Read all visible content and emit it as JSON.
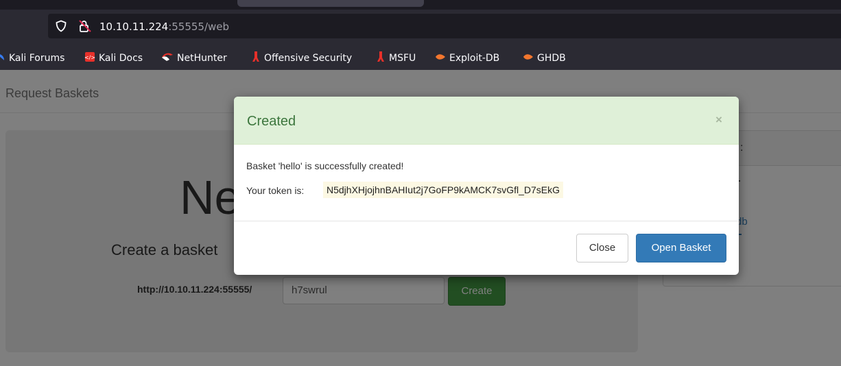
{
  "browser": {
    "url_host": "10.10.11.224",
    "url_rest": ":55555/web",
    "bookmarks": [
      {
        "label": "Kali Forums",
        "icon": "kali-dragon-icon"
      },
      {
        "label": "Kali Docs",
        "icon": "kali-docs-icon"
      },
      {
        "label": "NetHunter",
        "icon": "nethunter-icon"
      },
      {
        "label": "Offensive Security",
        "icon": "offsec-icon"
      },
      {
        "label": "MSFU",
        "icon": "offsec-icon"
      },
      {
        "label": "Exploit-DB",
        "icon": "exploitdb-icon"
      },
      {
        "label": "GHDB",
        "icon": "exploitdb-icon"
      }
    ]
  },
  "page": {
    "brand": "Request Baskets",
    "heading_fragment": "Ne",
    "lead_fragment": "Create a basket",
    "basket_url_prefix": "http://10.10.11.224:55555/",
    "basket_name_value": "h7swrul",
    "create_label": "Create",
    "side_fragment_colon": ":",
    "side_fragment_link": "db"
  },
  "modal": {
    "title": "Created",
    "close_symbol": "×",
    "message": "Basket 'hello' is successfully created!",
    "token_label": "Your token is:",
    "token": "N5djhXHjojhnBAHIut2j7GoFP9kAMCK7svGfl_D7sEkG",
    "close_button": "Close",
    "open_button": "Open Basket"
  },
  "colors": {
    "modal_header_bg": "#dff0d8",
    "modal_title": "#3c763d",
    "token_highlight": "#fcf8e3",
    "primary_button": "#337ab7",
    "create_button": "#449d44"
  }
}
